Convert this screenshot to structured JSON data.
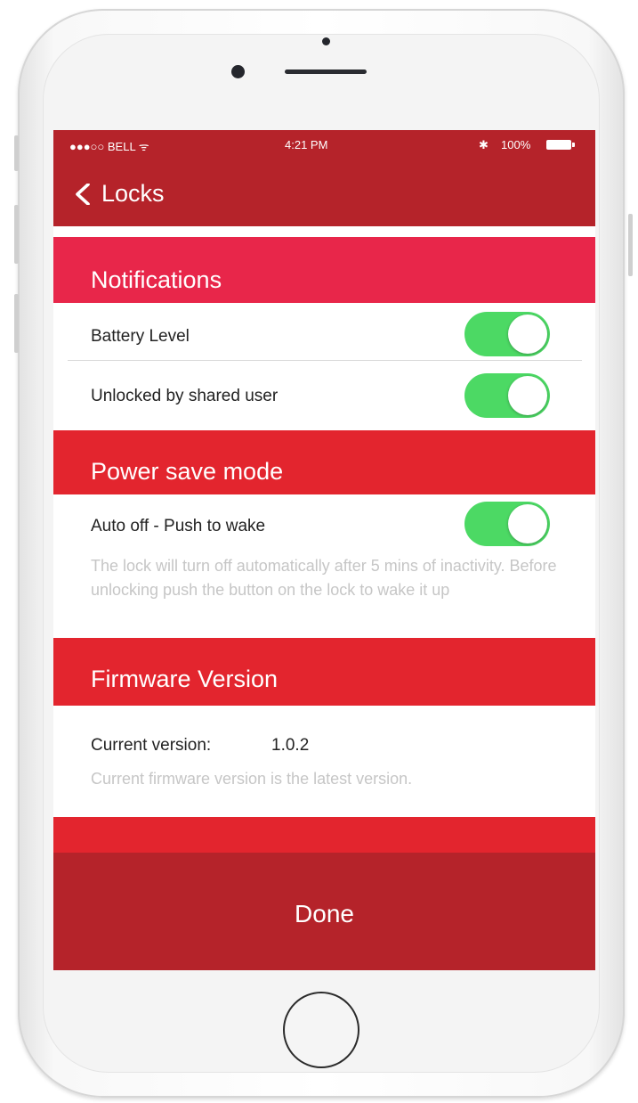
{
  "status_bar": {
    "carrier": "●●●○○ BELL ᯤ",
    "time": "4:21 PM",
    "bluetooth": "✱",
    "battery": "100%"
  },
  "nav": {
    "back_label": "Locks"
  },
  "sections": {
    "notifications": {
      "title": "Notifications",
      "battery_level": {
        "label": "Battery Level",
        "on": true
      },
      "unlocked_by_shared_user": {
        "label": "Unlocked by shared user",
        "on": true
      }
    },
    "power_save": {
      "title": "Power save mode",
      "auto_off": {
        "label": "Auto off - Push to wake",
        "on": true
      },
      "note": "The lock will turn off automatically after 5 mins of inactivity.  Before unlocking push the button on the lock to wake it up"
    },
    "firmware": {
      "title": "Firmware Version",
      "current_label": "Current version:",
      "current_value": "1.0.2",
      "note": "Current firmware version is the latest version."
    }
  },
  "footer": {
    "done_label": "Done"
  },
  "colors": {
    "nav_red": "#b5232a",
    "section_red": "#e3252e",
    "notifications_red": "#e8264a",
    "toggle_green": "#4cd964"
  },
  "icons": {
    "back": "chevron-left-icon",
    "bluetooth": "bluetooth-icon",
    "battery": "battery-icon",
    "wifi": "wifi-icon"
  }
}
